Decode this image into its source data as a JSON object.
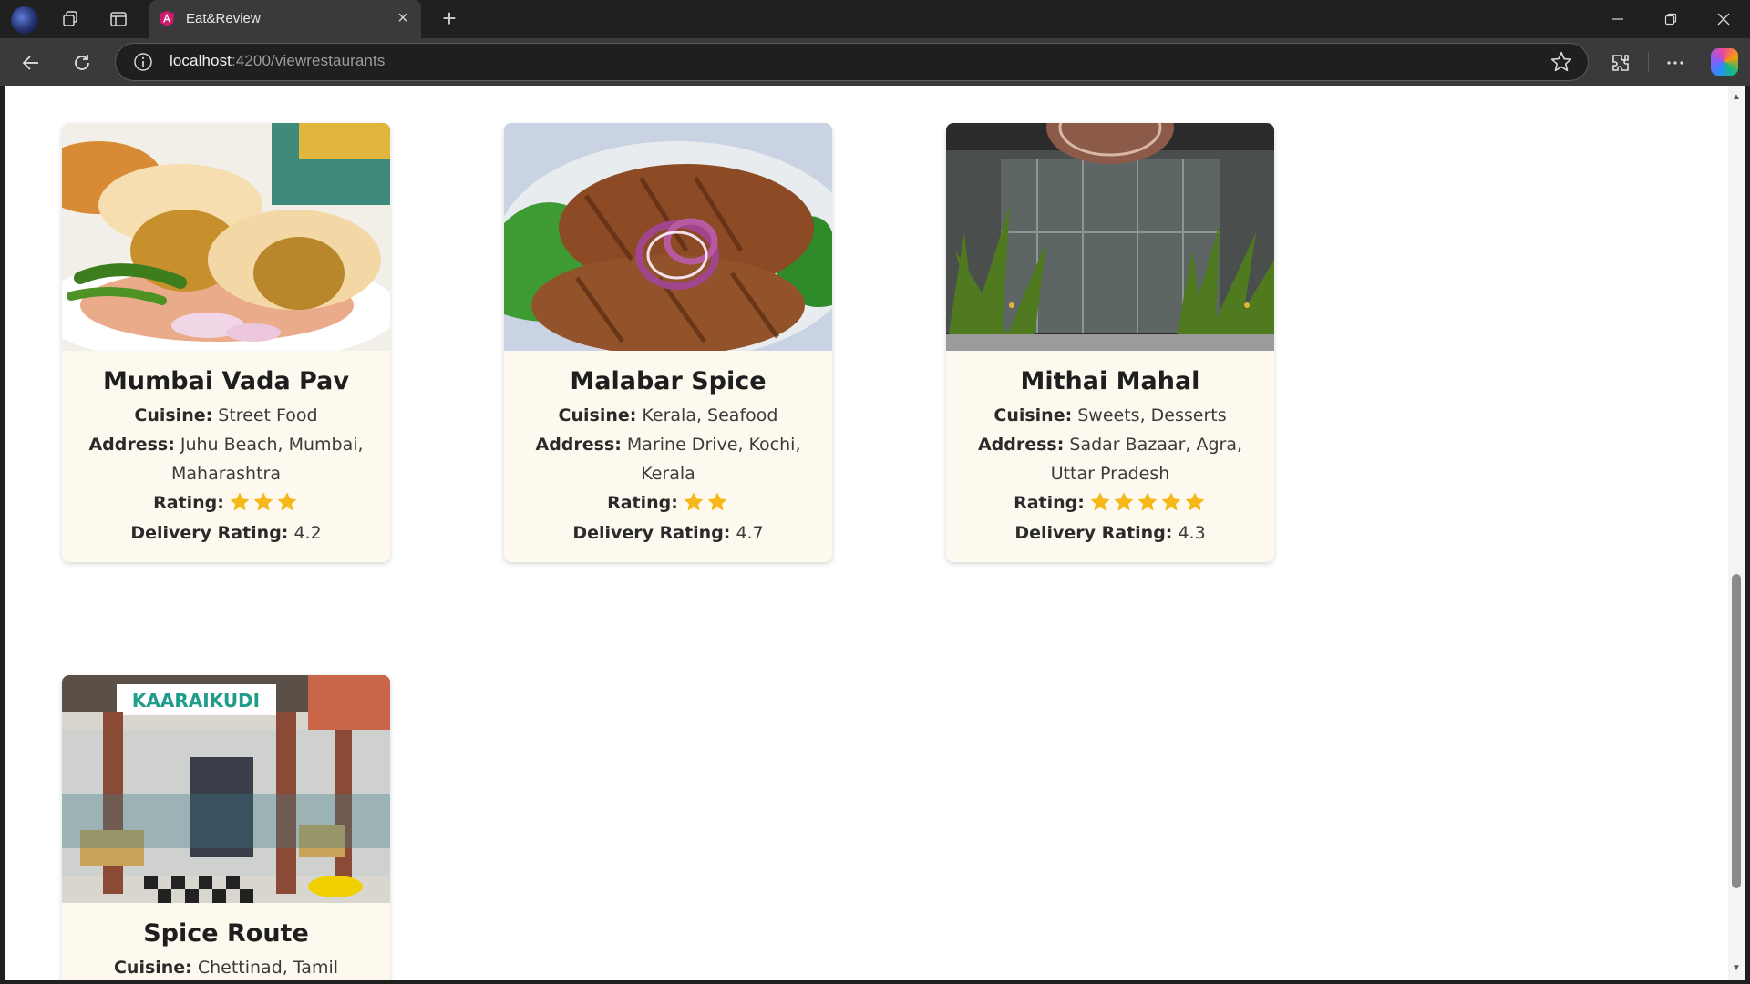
{
  "browser": {
    "tab_title": "Eat&Review",
    "url_host": "localhost",
    "url_path": ":4200/viewrestaurants"
  },
  "restaurants": [
    {
      "name": "Mumbai Vada Pav",
      "cuisine_label": "Cuisine:",
      "cuisine": " Street Food",
      "address_label": "Address:",
      "address": " Juhu Beach, Mumbai, Maharashtra",
      "rating_label": "Rating:",
      "rating_stars": 3,
      "delivery_label": "Delivery Rating:",
      "delivery": " 4.2"
    },
    {
      "name": "Malabar Spice",
      "cuisine_label": "Cuisine:",
      "cuisine": " Kerala, Seafood",
      "address_label": "Address:",
      "address": " Marine Drive, Kochi, Kerala",
      "rating_label": "Rating:",
      "rating_stars": 2,
      "delivery_label": "Delivery Rating:",
      "delivery": " 4.7"
    },
    {
      "name": "Mithai Mahal",
      "cuisine_label": "Cuisine:",
      "cuisine": " Sweets, Desserts",
      "address_label": "Address:",
      "address": " Sadar Bazaar, Agra, Uttar Pradesh",
      "rating_label": "Rating:",
      "rating_stars": 5,
      "delivery_label": "Delivery Rating:",
      "delivery": " 4.3"
    },
    {
      "name": "Spice Route",
      "cuisine_label": "Cuisine:",
      "cuisine": " Chettinad, Tamil",
      "sign_text": "KAARAIKUDI"
    }
  ],
  "colors": {
    "card_bg": "#fdf9ef",
    "star": "#f5b818",
    "chrome_dark": "#202020",
    "chrome_mid": "#3a3a3a"
  }
}
